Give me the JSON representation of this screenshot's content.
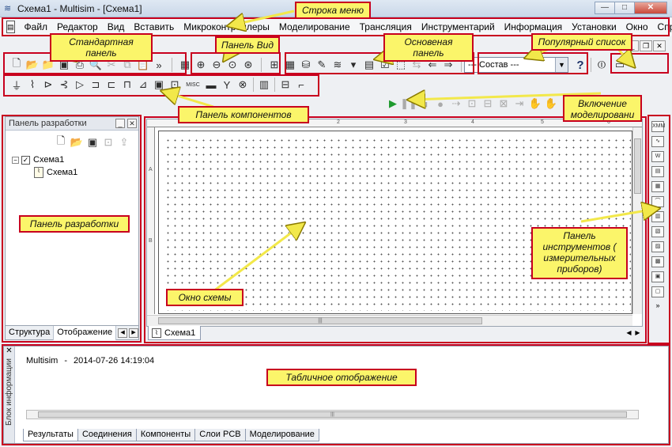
{
  "window": {
    "title": "Схема1 - Multisim - [Схема1]",
    "buttons": [
      "—",
      "□",
      "✕"
    ]
  },
  "menu": [
    "Файл",
    "Редактор",
    "Вид",
    "Вставить",
    "Микроконтроллеры",
    "Моделирование",
    "Трансляция",
    "Инструментарий",
    "Информация",
    "Установки",
    "Окно",
    "Справка"
  ],
  "toolbars": {
    "standard_icons": [
      "new-icon",
      "open-icon",
      "open-sample-icon",
      "save-icon",
      "print-icon",
      "print-preview-icon",
      "cut-icon",
      "copy-icon",
      "paste-icon",
      "more-icon"
    ],
    "view_icons": [
      "fullscreen-icon",
      "zoom-in-icon",
      "zoom-out-icon",
      "zoom-area-icon",
      "zoom-fit-icon"
    ],
    "main_icons": [
      "hierarchy-icon",
      "spreadsheet-icon",
      "database-icon",
      "component-wizard-icon",
      "postprocessor-icon",
      "grapher-icon",
      "erc-icon",
      "back-annotate-icon",
      "forward-annotate-icon",
      "transfer-icon"
    ],
    "in_use_list": "--- Состав ---",
    "help_glyph": "?",
    "components_icons": [
      "source-icon",
      "basic-icon",
      "diode-icon",
      "transistor-icon",
      "analog-icon",
      "ttl-icon",
      "cmos-icon",
      "misc-digital-icon",
      "mixed-icon",
      "indicator-icon",
      "power-icon",
      "misc-icon",
      "advanced-peripherals-icon",
      "rf-icon",
      "electromechanical-icon",
      "mcu-icon",
      "hierarchical-block-icon",
      "bus-icon"
    ],
    "misc_label": "MISC",
    "simulation_icons": [
      "run-icon",
      "pause-icon",
      "stop-icon",
      "probe-icon",
      "step-icon"
    ]
  },
  "design_panel": {
    "title": "Панель разработки",
    "tree_root": "Схема1",
    "tree_child": "Схема1",
    "tabs": [
      "Структура",
      "Отображение"
    ]
  },
  "workspace": {
    "sheet_tab": "Схема1",
    "ruler_marks": [
      "1",
      "2",
      "3",
      "4",
      "5",
      "6"
    ],
    "ruler_rows": [
      "A",
      "B"
    ]
  },
  "instrument_icons": [
    "multimeter-icon",
    "function-generator-icon",
    "wattmeter-icon",
    "oscilloscope-icon",
    "four-channel-oscilloscope-icon",
    "bode-plotter-icon",
    "frequency-counter-icon",
    "word-generator-icon",
    "logic-analyzer-icon",
    "logic-converter-icon",
    "iv-analyzer-icon",
    "distortion-analyzer-icon"
  ],
  "spreadsheet": {
    "side_label": "Блок информации",
    "log_app": "Multisim",
    "log_sep": "-",
    "log_time": "2014-07-26 14:19:04",
    "tabs": [
      "Результаты",
      "Соединения",
      "Компоненты",
      "Слои PCB",
      "Моделирование"
    ]
  },
  "annotations": {
    "menu_bar": "Строка меню",
    "standard_panel": "Стандартная панель",
    "view_panel": "Панель Вид",
    "main_panel": "Основеная панель",
    "in_use_list": "Популярный список",
    "components_panel": "Панель компонентов",
    "simulation_switch": "Включение моделировани",
    "design_panel": "Панель разработки",
    "schematic_window": "Окно схемы",
    "instruments_panel": "Панель инструментов ( измерительных приборов)",
    "spreadsheet_view": "Табличное отображение"
  },
  "colors": {
    "annotation_fill": "#fbf56a",
    "annotation_border": "#c8001e",
    "arrow": "#f2e84a"
  }
}
